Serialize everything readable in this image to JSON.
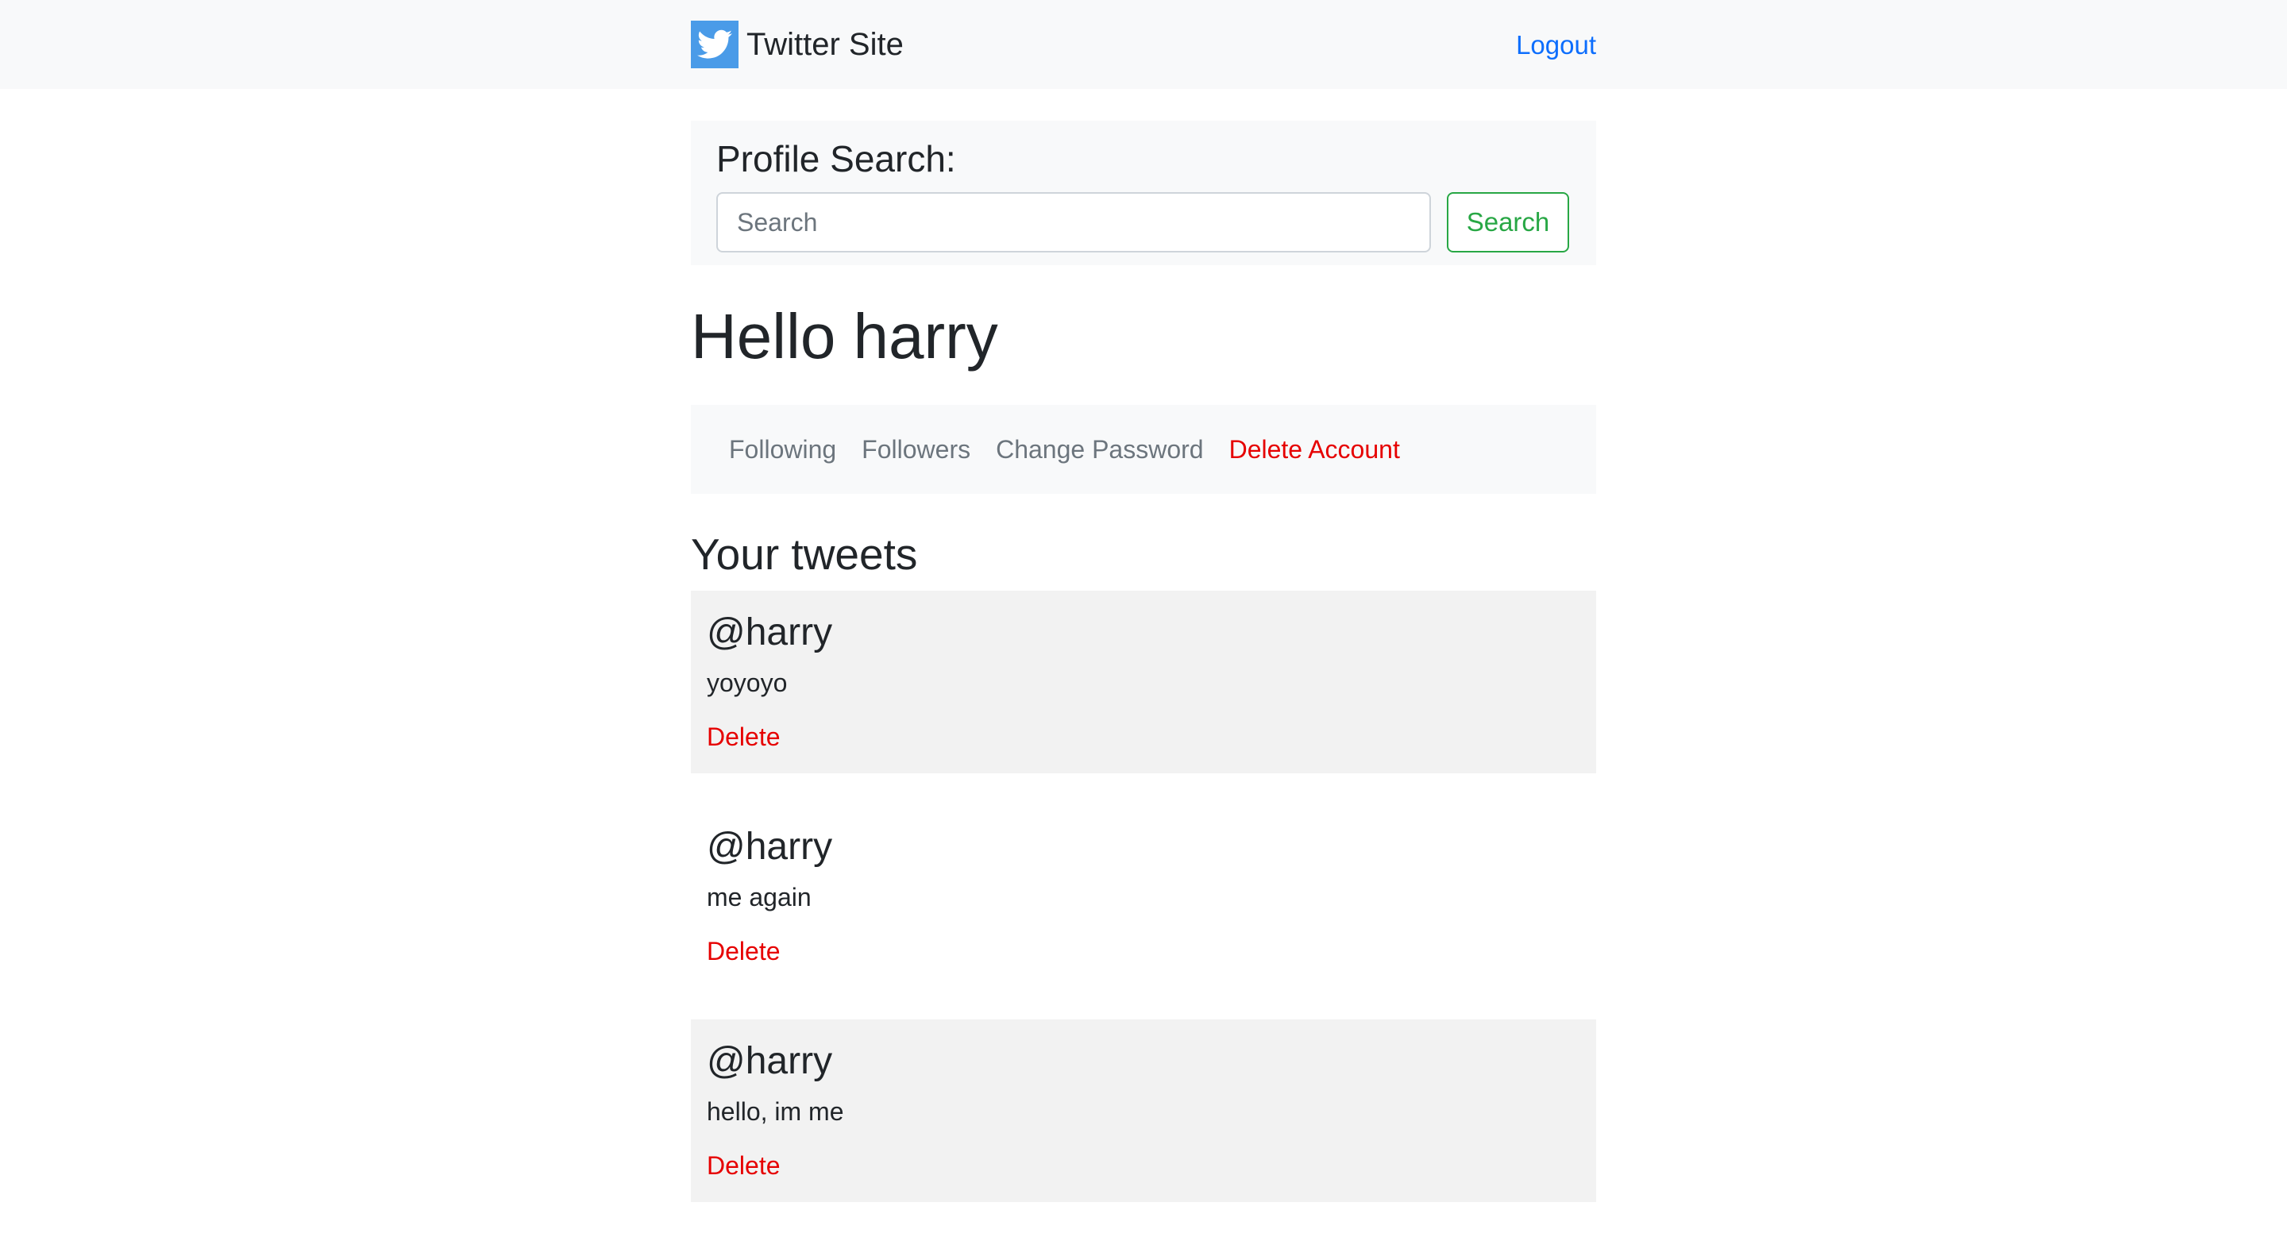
{
  "navbar": {
    "brand": "Twitter Site",
    "brand_icon": "twitter-bird-icon",
    "logout": "Logout"
  },
  "search": {
    "title": "Profile Search:",
    "placeholder": "Search",
    "value": "",
    "button": "Search"
  },
  "greeting": "Hello harry",
  "subnav": {
    "following": "Following",
    "followers": "Followers",
    "change_password": "Change Password",
    "delete_account": "Delete Account"
  },
  "tweets_section": {
    "title": "Your tweets",
    "tweets": [
      {
        "handle": "@harry",
        "text": "yoyoyo",
        "delete": "Delete"
      },
      {
        "handle": "@harry",
        "text": "me again",
        "delete": "Delete"
      },
      {
        "handle": "@harry",
        "text": "hello, im me",
        "delete": "Delete"
      }
    ]
  },
  "colors": {
    "link": "#0d6efd",
    "danger": "#e60000",
    "success": "#28a745",
    "brand_blue": "#4a9be8"
  }
}
